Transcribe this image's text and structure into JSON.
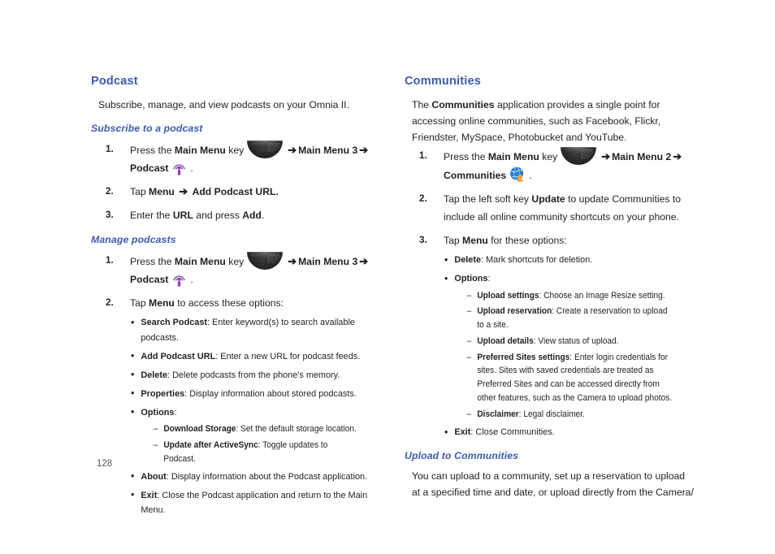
{
  "page": {
    "number": "128",
    "heading_color": "#3c5bb0",
    "text_color": "#231f20",
    "background": "#ffffff"
  },
  "left_column": {
    "section_title": "Podcast",
    "intro": "Subscribe, manage, and view podcasts on your Omnia II.",
    "subsections": [
      {
        "title": "Subscribe to a podcast",
        "steps": [
          {
            "num": "1.",
            "pre": "Press the",
            "bold1": "Main Menu",
            "mid": "key",
            "icon": "main-menu-key-icon",
            "arrow1": "➔",
            "bold2": "Main Menu 3",
            "arrow2": "➔",
            "bold3": "Podcast",
            "icon2": "podcast-app-icon",
            "end": "."
          },
          {
            "num": "2.",
            "pre": "Tap",
            "bold1": "Menu",
            "arrow1": "➔",
            "bold2": "Add Podcast URL."
          },
          {
            "num": "3.",
            "pre": "Enter the",
            "bold1": "URL",
            "mid": "and press",
            "bold2": "Add",
            "end": "."
          }
        ]
      },
      {
        "title": "Manage podcasts",
        "steps": [
          {
            "num": "1.",
            "pre": "Press the",
            "bold1": "Main Menu",
            "mid": "key",
            "icon": "main-menu-key-icon",
            "arrow1": "➔",
            "bold2": "Main Menu 3",
            "arrow2": "➔",
            "bold3": "Podcast",
            "icon2": "podcast-app-icon",
            "end": "."
          },
          {
            "num": "2.",
            "pre": "Tap",
            "bold1": "Menu",
            "mid": "to access these options:"
          }
        ],
        "bullets": [
          {
            "term": "Search Podcast",
            "desc": ": Enter keyword(s) to search available podcasts."
          },
          {
            "term": "Add Podcast URL",
            "desc": ": Enter a new URL for podcast feeds."
          },
          {
            "term": "Delete",
            "desc": ": Delete podcasts from the phone's memory."
          },
          {
            "term": "Properties",
            "desc": ": Display information about stored podcasts."
          },
          {
            "term": "Options",
            "desc": ":",
            "sub": [
              {
                "term": "Download Storage",
                "desc": ": Set the default storage location."
              },
              {
                "term": "Update after ActiveSync",
                "desc": ": Toggle updates to Podcast."
              }
            ]
          },
          {
            "term": "About",
            "desc": ": Display information about the Podcast application."
          },
          {
            "term": "Exit",
            "desc": ": Close the Podcast application and return to the Main Menu."
          }
        ]
      }
    ]
  },
  "right_column": {
    "section_title": "Communities",
    "intro_pre": "The ",
    "intro_bold": "Communities",
    "intro_post": " application provides a single point for accessing online communities, such as Facebook, Flickr, Friendster, MySpace, Photobucket and YouTube.",
    "steps": [
      {
        "num": "1.",
        "pre": "Press the",
        "bold1": "Main Menu",
        "mid": "key",
        "icon": "main-menu-key-icon",
        "arrow1": "➔",
        "bold2": "Main Menu 2",
        "arrow2": "➔",
        "bold3": "Communities",
        "icon2": "communities-app-icon",
        "end": "."
      },
      {
        "num": "2.",
        "pre": "Tap the left soft key",
        "bold1": "Update",
        "mid": "to update Communities to include all online community shortcuts on your phone."
      },
      {
        "num": "3.",
        "pre": "Tap",
        "bold1": "Menu",
        "mid": "for these options:"
      }
    ],
    "bullets": [
      {
        "term": "Delete",
        "desc": ": Mark shortcuts for deletion."
      },
      {
        "term": "Options",
        "desc": ":",
        "sub": [
          {
            "term": "Upload settings",
            "desc": ": Choose an Image Resize setting."
          },
          {
            "term": "Upload reservation",
            "desc": ": Create a reservation to upload to a site."
          },
          {
            "term": "Upload details",
            "desc": ": View status of upload."
          },
          {
            "term": "Preferred Sites settings",
            "desc": ": Enter login credentials for sites. Sites with saved credentials are treated as Preferred Sites and can be accessed directly from other features, such as the Camera to upload photos."
          },
          {
            "term": "Disclaimer",
            "desc": ": Legal disclaimer."
          }
        ]
      },
      {
        "term": "Exit",
        "desc": ": Close Communities."
      }
    ],
    "subsection": {
      "title": "Upload to Communities",
      "body": "You can upload to a community, set up a reservation to upload at a specified time and date, or upload directly from the Camera/"
    }
  }
}
